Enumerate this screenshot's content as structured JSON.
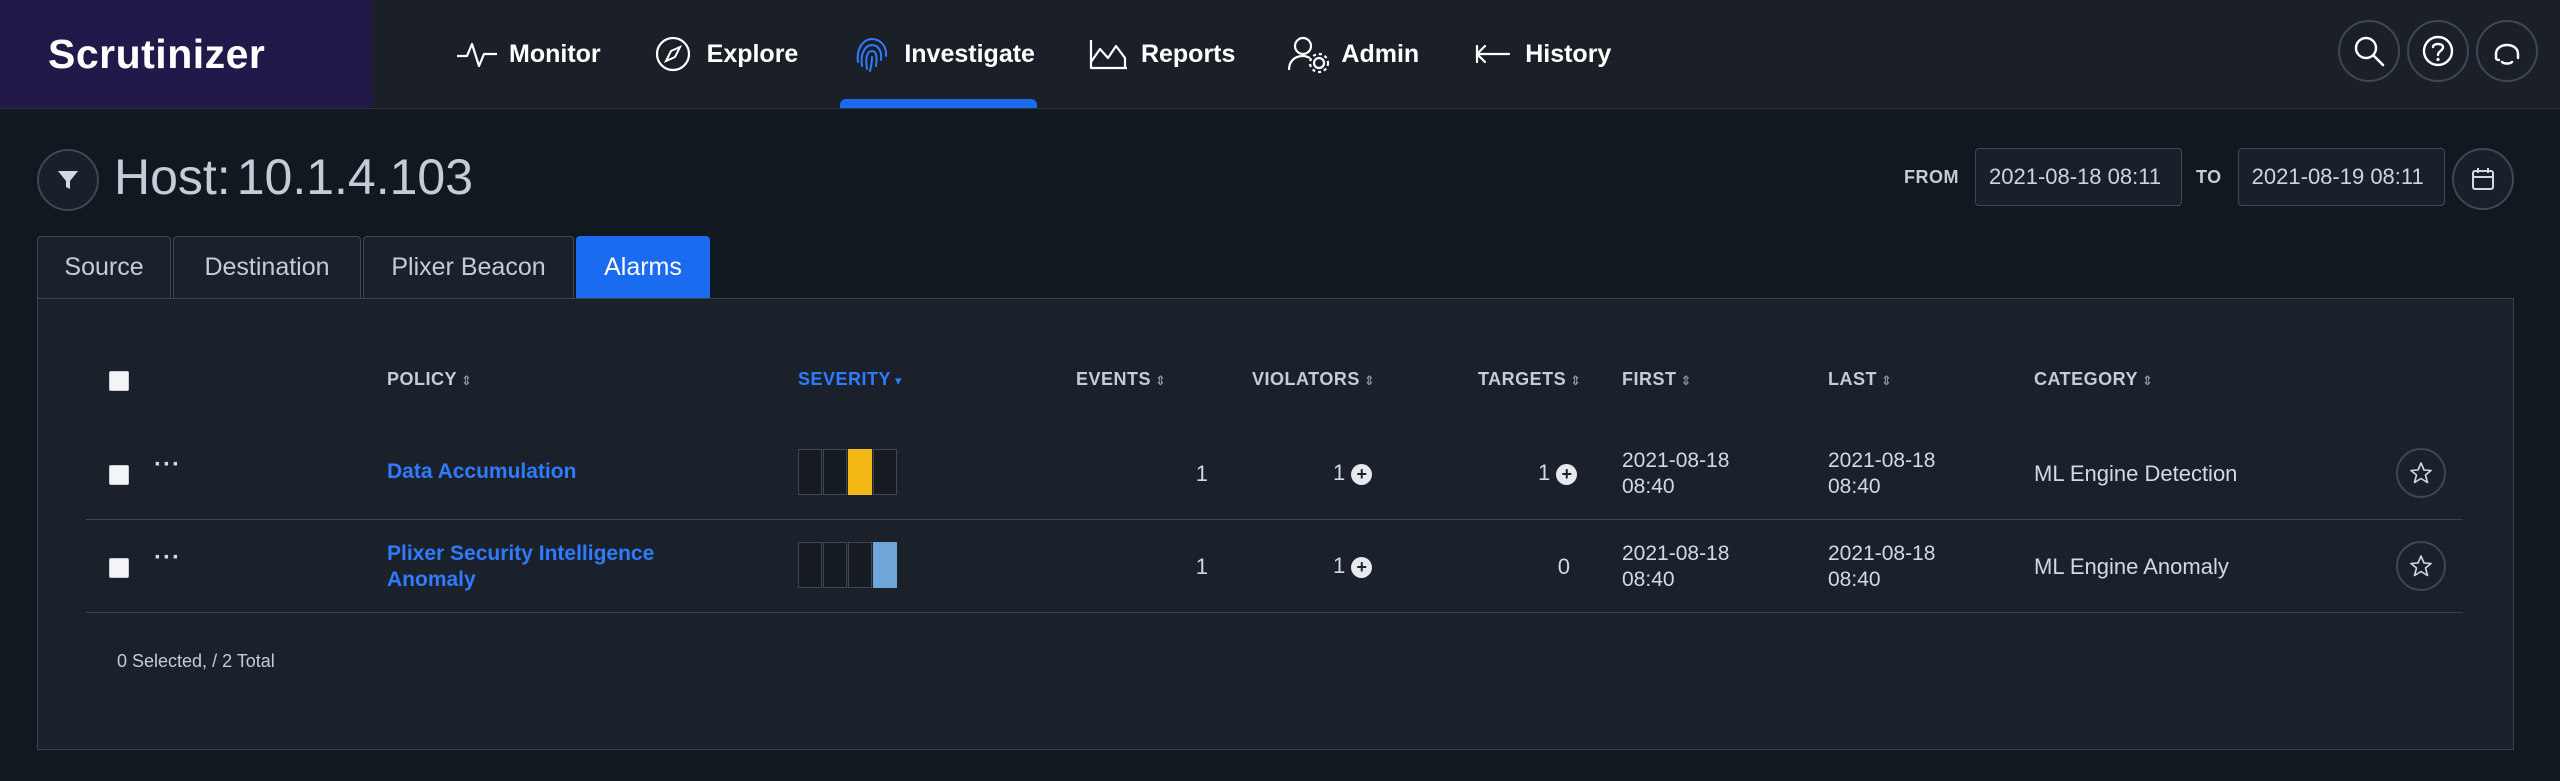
{
  "app": {
    "brand": "Scrutinizer"
  },
  "nav": [
    {
      "label": "Monitor",
      "icon": "pulse-icon",
      "active": false
    },
    {
      "label": "Explore",
      "icon": "compass-icon",
      "active": false
    },
    {
      "label": "Investigate",
      "icon": "fingerprint-icon",
      "active": true
    },
    {
      "label": "Reports",
      "icon": "area-chart-icon",
      "active": false
    },
    {
      "label": "Admin",
      "icon": "user-gear-icon",
      "active": false
    },
    {
      "label": "History",
      "icon": "arrow-left-icon",
      "active": false
    }
  ],
  "top_icons": [
    "search-icon",
    "help-icon",
    "headset-icon"
  ],
  "header": {
    "title": "Host:",
    "host": "10.1.4.103"
  },
  "date_range": {
    "from_label": "FROM",
    "from_value": "2021-08-18 08:11",
    "to_label": "TO",
    "to_value": "2021-08-19 08:11"
  },
  "tabs": [
    {
      "label": "Source",
      "active": false
    },
    {
      "label": "Destination",
      "active": false
    },
    {
      "label": "Plixer Beacon",
      "active": false
    },
    {
      "label": "Alarms",
      "active": true
    }
  ],
  "table": {
    "columns": {
      "policy": "POLICY",
      "severity": "SEVERITY",
      "events": "EVENTS",
      "violators": "VIOLATORS",
      "targets": "TARGETS",
      "first": "FIRST",
      "last": "LAST",
      "category": "CATEGORY"
    },
    "sorted_column": "severity",
    "rows": [
      {
        "policy_line1": "Data Accumulation",
        "policy_line2": "",
        "severity_level": 3,
        "severity_color": "#f5b915",
        "events": "1",
        "violators": "1",
        "targets": "1",
        "first_date": "2021-08-18",
        "first_time": "08:40",
        "last_date": "2021-08-18",
        "last_time": "08:40",
        "category": "ML Engine Detection"
      },
      {
        "policy_line1": "Plixer Security Intelligence",
        "policy_line2": "Anomaly",
        "severity_level": 4,
        "severity_color": "#6fa8d8",
        "events": "1",
        "violators": "1",
        "targets": "0",
        "first_date": "2021-08-18",
        "first_time": "08:40",
        "last_date": "2021-08-18",
        "last_time": "08:40",
        "category": "ML Engine Anomaly"
      }
    ],
    "footer": "0 Selected, / 2 Total"
  },
  "colors": {
    "accent": "#1a6bf0",
    "brand_bg": "#22184a",
    "bg": "#111820",
    "panel": "#1b212a"
  }
}
